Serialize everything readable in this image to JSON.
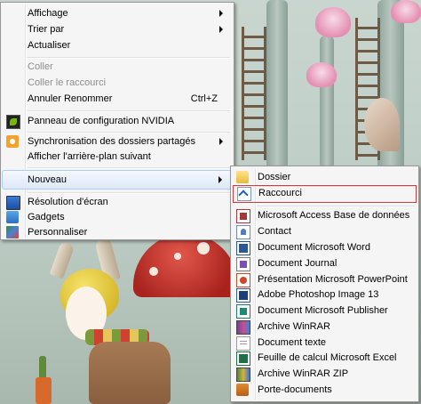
{
  "context_menu": {
    "items": [
      {
        "label": "Affichage"
      },
      {
        "label": "Trier par"
      },
      {
        "label": "Actualiser"
      },
      {
        "label": "Coller"
      },
      {
        "label": "Coller le raccourci"
      },
      {
        "label": "Annuler Renommer",
        "shortcut": "Ctrl+Z"
      },
      {
        "label": "Panneau de configuration NVIDIA",
        "icon": "nvidia-icon"
      },
      {
        "label": "Synchronisation des dossiers partagés",
        "icon": "sync-folders-icon"
      },
      {
        "label": "Afficher l'arrière-plan suivant"
      },
      {
        "label": "Nouveau"
      },
      {
        "label": "Résolution d'écran",
        "icon": "screen-resolution-icon"
      },
      {
        "label": "Gadgets",
        "icon": "gadgets-icon"
      },
      {
        "label": "Personnaliser",
        "icon": "personalize-icon"
      }
    ]
  },
  "submenu_nouveau": {
    "items": [
      {
        "label": "Dossier",
        "icon": "folder-icon"
      },
      {
        "label": "Raccourci",
        "icon": "shortcut-icon"
      },
      {
        "label": "Microsoft Access Base de données",
        "icon": "access-icon"
      },
      {
        "label": "Contact",
        "icon": "contact-icon"
      },
      {
        "label": "Document Microsoft Word",
        "icon": "word-icon"
      },
      {
        "label": "Document Journal",
        "icon": "journal-icon"
      },
      {
        "label": "Présentation Microsoft PowerPoint",
        "icon": "powerpoint-icon"
      },
      {
        "label": "Adobe Photoshop Image 13",
        "icon": "photoshop-icon"
      },
      {
        "label": "Document Microsoft Publisher",
        "icon": "publisher-icon"
      },
      {
        "label": "Archive WinRAR",
        "icon": "winrar-icon"
      },
      {
        "label": "Document texte",
        "icon": "text-document-icon"
      },
      {
        "label": "Feuille de calcul Microsoft Excel",
        "icon": "excel-icon"
      },
      {
        "label": "Archive WinRAR ZIP",
        "icon": "winrar-zip-icon"
      },
      {
        "label": "Porte-documents",
        "icon": "briefcase-icon"
      }
    ]
  },
  "colors": {
    "menu_background": "#f5f5f5",
    "menu_border": "#979797",
    "hover_highlight": "#dce9f8",
    "selection_box": "#d33b3b",
    "disabled_text": "#8d8d8d"
  }
}
